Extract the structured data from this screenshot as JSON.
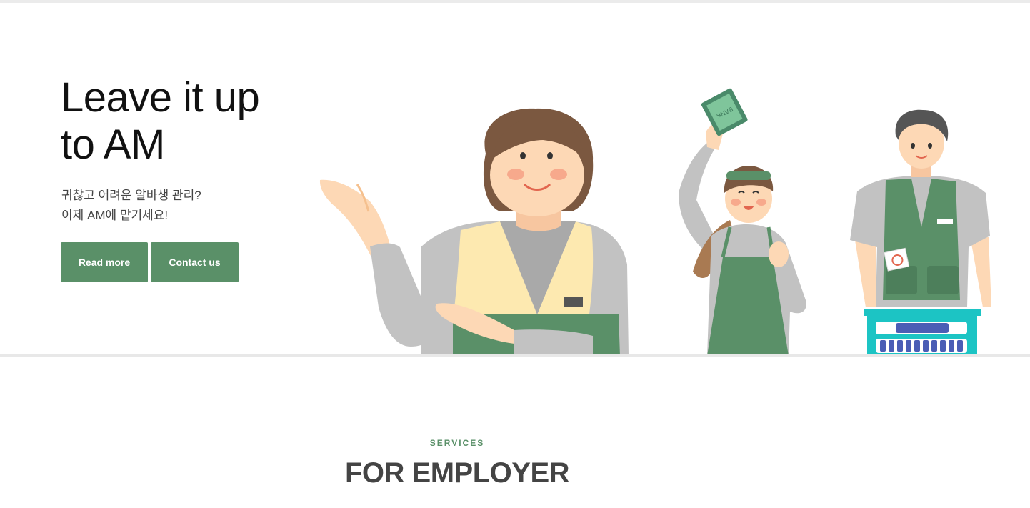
{
  "hero": {
    "title_line1": "Leave it up",
    "title_line2": "to AM",
    "subtitle_line1": "귀찮고 어려운 알바생 관리?",
    "subtitle_line2": "이제 AM에 맡기세요!",
    "read_more_label": "Read more",
    "contact_label": "Contact us",
    "book_label": "BANK"
  },
  "services": {
    "label": "SERVICES",
    "title": "FOR EMPLOYER"
  },
  "colors": {
    "accent": "#5a9068",
    "vest_green": "#5a9068",
    "vest_yellow": "#fde9b0",
    "sleeve_gray": "#c2c2c2",
    "hair_brown": "#7b5840",
    "skin": "#fdd8b5",
    "basket": "#1cc4c4"
  },
  "icons": [
    "employee-woman-illustration",
    "employee-girl-illustration",
    "employee-man-illustration"
  ]
}
